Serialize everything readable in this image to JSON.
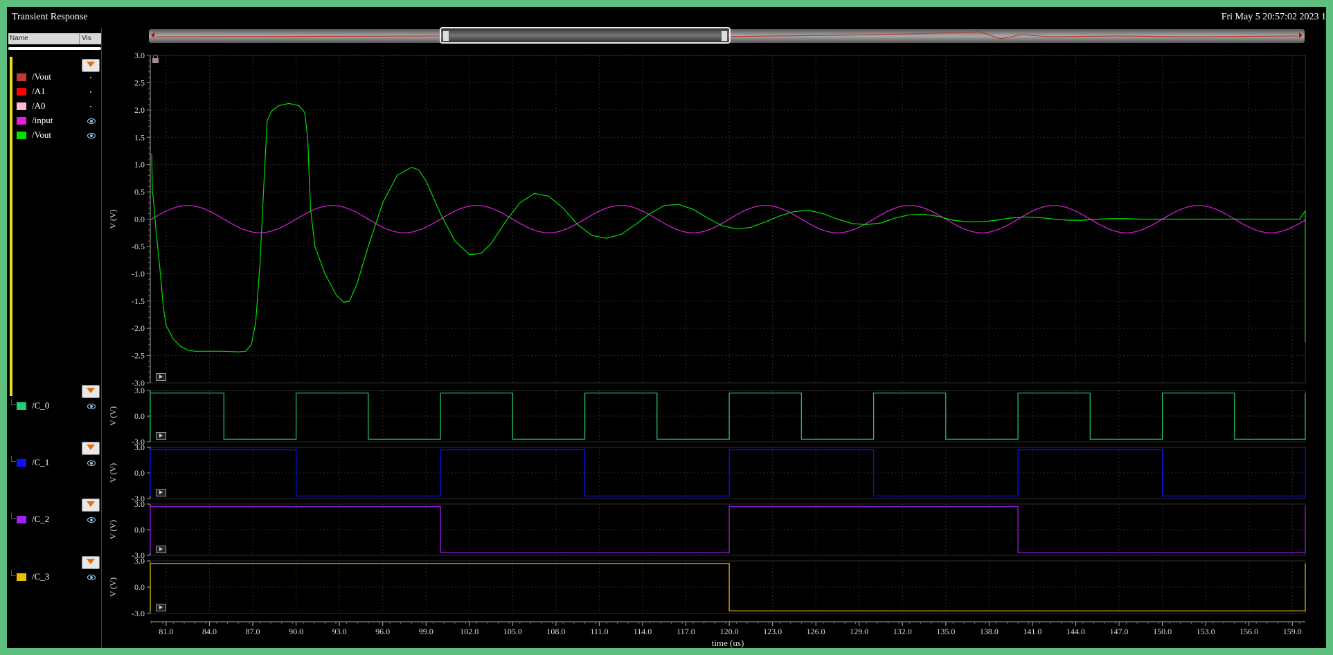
{
  "window": {
    "title": "Transient Response",
    "datestamp": "Fri May 5 20:57:02 2023   1"
  },
  "legend": {
    "header_name": "Name",
    "header_vis": "Vis",
    "items": [
      {
        "name": "/Vout",
        "color": "#c0392b",
        "visible": false
      },
      {
        "name": "/A1",
        "color": "#ff0000",
        "visible": false
      },
      {
        "name": "/A0",
        "color": "#ffb6d9",
        "visible": false
      },
      {
        "name": "/input",
        "color": "#e020e0",
        "visible": true
      },
      {
        "name": "/Vout",
        "color": "#00e000",
        "visible": true
      }
    ],
    "sub_items": [
      {
        "name": "/C_0",
        "color": "#20d070"
      },
      {
        "name": "/C_1",
        "color": "#1010ff"
      },
      {
        "name": "/C_2",
        "color": "#a020f0"
      },
      {
        "name": "/C_3",
        "color": "#e8c000"
      }
    ]
  },
  "chart_data": [
    {
      "type": "line",
      "panel": "main",
      "xlabel": "time (us)",
      "ylabel": "V (V)",
      "xlim": [
        79.9,
        159.9
      ],
      "ylim": [
        -3.0,
        3.0
      ],
      "yticks": [
        "3.0",
        "2.5",
        "2.0",
        "1.5",
        "1.0",
        "0.5",
        "0.0",
        "-0.5",
        "-1.0",
        "-1.5",
        "-2.0",
        "-2.5",
        "-3.0"
      ],
      "grid": true,
      "series": [
        {
          "name": "/input",
          "color": "#e020e0",
          "description_points": {
            "x": [
              80,
              81.25,
              82.5,
              83.75,
              85,
              86.25,
              87.5,
              88.75,
              90,
              91.25,
              92.5,
              93.75,
              95,
              96.25,
              97.5,
              98.75,
              100,
              101.25,
              102.5,
              103.75,
              105,
              106.25,
              107.5,
              108.75,
              110,
              111.25,
              112.5,
              113.75,
              115,
              116.25,
              117.5,
              118.75,
              120,
              121.25,
              122.5,
              123.75,
              125,
              126.25,
              127.5,
              128.75,
              130,
              131.25,
              132.5,
              133.75,
              135,
              136.25,
              137.5,
              138.75,
              140,
              141.25,
              142.5,
              143.75,
              145,
              146.25,
              147.5,
              148.75,
              150,
              151.25,
              152.5,
              153.75,
              155,
              156.25,
              157.5,
              158.75,
              160
            ],
            "y": [
              0,
              0.177,
              0.25,
              0.177,
              0,
              -0.177,
              -0.25,
              -0.177,
              0,
              0.177,
              0.25,
              0.177,
              0,
              -0.177,
              -0.25,
              -0.177,
              0,
              0.177,
              0.25,
              0.177,
              0,
              -0.177,
              -0.25,
              -0.177,
              0,
              0.177,
              0.25,
              0.177,
              0,
              -0.177,
              -0.25,
              -0.177,
              0,
              0.177,
              0.25,
              0.177,
              0,
              -0.177,
              -0.25,
              -0.177,
              0,
              0.177,
              0.25,
              0.177,
              0,
              -0.177,
              -0.25,
              -0.177,
              0,
              0.177,
              0.25,
              0.177,
              0,
              -0.177,
              -0.25,
              -0.177,
              0,
              0.177,
              0.25,
              0.177,
              0,
              -0.177,
              -0.25,
              -0.177,
              0
            ]
          }
        },
        {
          "name": "/Vout",
          "color": "#00e000",
          "description_points": {
            "x": [
              80,
              80.05,
              80.1,
              80.3,
              80.6,
              80.8,
              81.0,
              81.5,
              82.0,
              82.5,
              83.0,
              84.0,
              85.0,
              86.0,
              86.5,
              86.9,
              87.2,
              87.5,
              87.8,
              88.0,
              88.3,
              88.8,
              89.5,
              90.2,
              90.6,
              90.8,
              91.0,
              91.3,
              92.0,
              92.8,
              93.3,
              93.7,
              94.2,
              95.0,
              96.0,
              97.0,
              98.0,
              98.5,
              99.0,
              100.0,
              101.0,
              102.0,
              102.8,
              103.5,
              104.5,
              105.5,
              106.5,
              107.5,
              108.5,
              109.5,
              110.5,
              111.5,
              112.5,
              113.5,
              114.5,
              115.5,
              116.5,
              117.5,
              118.5,
              119.5,
              120.5,
              121.5,
              122.5,
              123.5,
              124.5,
              125.5,
              126.5,
              127.5,
              128.5,
              129.5,
              130.5,
              131.5,
              132.5,
              133.5,
              134.5,
              135.5,
              136.5,
              137.5,
              138.5,
              139.5,
              140.5,
              141.5,
              142.5,
              143.5,
              144.5,
              145.5,
              146.5,
              147.5,
              148.5,
              149.5,
              150.5,
              151.5,
              152.5,
              153.5,
              154.5,
              155.5,
              156.5,
              157.5,
              158.5,
              159.5,
              159.9,
              159.9,
              159.9
            ],
            "y": [
              1.2,
              0.5,
              0.4,
              -0.2,
              -1.0,
              -1.6,
              -1.95,
              -2.2,
              -2.33,
              -2.4,
              -2.42,
              -2.42,
              -2.42,
              -2.43,
              -2.42,
              -2.3,
              -1.9,
              -0.8,
              0.8,
              1.8,
              1.98,
              2.08,
              2.12,
              2.08,
              1.95,
              1.5,
              0.2,
              -0.5,
              -1.0,
              -1.4,
              -1.52,
              -1.5,
              -1.2,
              -0.5,
              0.3,
              0.8,
              0.95,
              0.9,
              0.7,
              0.1,
              -0.4,
              -0.65,
              -0.63,
              -0.45,
              -0.05,
              0.3,
              0.47,
              0.42,
              0.2,
              -0.1,
              -0.3,
              -0.35,
              -0.28,
              -0.1,
              0.1,
              0.25,
              0.27,
              0.18,
              0.02,
              -0.12,
              -0.18,
              -0.15,
              -0.05,
              0.06,
              0.14,
              0.16,
              0.1,
              0.0,
              -0.08,
              -0.1,
              -0.07,
              0.02,
              0.08,
              0.09,
              0.05,
              -0.02,
              -0.05,
              -0.05,
              -0.02,
              0.02,
              0.04,
              0.03,
              0.0,
              -0.02,
              -0.02,
              0.0,
              0.01,
              0.01,
              0.0,
              0.0,
              0.0,
              0.0,
              0.0,
              0.0,
              0.0,
              0.0,
              0.0,
              0.0,
              0.0,
              0.0,
              0.15,
              -2.25
            ]
          }
        }
      ]
    },
    {
      "type": "line",
      "panel": "C_0",
      "ylabel": "V (V)",
      "ylim": [
        -3.0,
        3.0
      ],
      "yticks": [
        "3.0",
        "0.0",
        "-3.0"
      ],
      "series": [
        {
          "name": "/C_0",
          "color": "#20d070",
          "high": 2.7,
          "low": -2.7,
          "period": 10,
          "start_high": true
        }
      ]
    },
    {
      "type": "line",
      "panel": "C_1",
      "ylabel": "V (V)",
      "ylim": [
        -3.0,
        3.0
      ],
      "yticks": [
        "3.0",
        "0.0",
        "-3.0"
      ],
      "series": [
        {
          "name": "/C_1",
          "color": "#1010ff",
          "high": 2.7,
          "low": -2.7,
          "period": 20,
          "start_high": true
        }
      ]
    },
    {
      "type": "line",
      "panel": "C_2",
      "ylabel": "V (V)",
      "ylim": [
        -3.0,
        3.0
      ],
      "yticks": [
        "3.0",
        "0.0",
        "-3.0"
      ],
      "series": [
        {
          "name": "/C_2",
          "color": "#a020f0",
          "high": 2.7,
          "low": -2.7,
          "period": 40,
          "start_high": true
        }
      ]
    },
    {
      "type": "line",
      "panel": "C_3",
      "ylabel": "V (V)",
      "ylim": [
        -3.0,
        3.0
      ],
      "yticks": [
        "3.0",
        "0.0",
        "-3.0"
      ],
      "series": [
        {
          "name": "/C_3",
          "color": "#e8c000",
          "high": 2.7,
          "low": -2.7,
          "period": 80,
          "start_high": true
        }
      ]
    }
  ],
  "xaxis": {
    "label": "time (us)",
    "ticks": [
      "81.0",
      "84.0",
      "87.0",
      "90.0",
      "93.0",
      "96.0",
      "99.0",
      "102.0",
      "105.0",
      "108.0",
      "111.0",
      "114.0",
      "117.0",
      "120.0",
      "123.0",
      "126.0",
      "129.0",
      "132.0",
      "135.0",
      "138.0",
      "141.0",
      "144.0",
      "147.0",
      "150.0",
      "153.0",
      "156.0",
      "159.0"
    ],
    "tick_values": [
      81,
      84,
      87,
      90,
      93,
      96,
      99,
      102,
      105,
      108,
      111,
      114,
      117,
      120,
      123,
      126,
      129,
      132,
      135,
      138,
      141,
      144,
      147,
      150,
      153,
      156,
      159
    ]
  },
  "colors": {
    "background": "#000000",
    "grid": "#2a2a2a",
    "axis_text": "#dddddd",
    "frame_border": "#5fbf7f"
  }
}
